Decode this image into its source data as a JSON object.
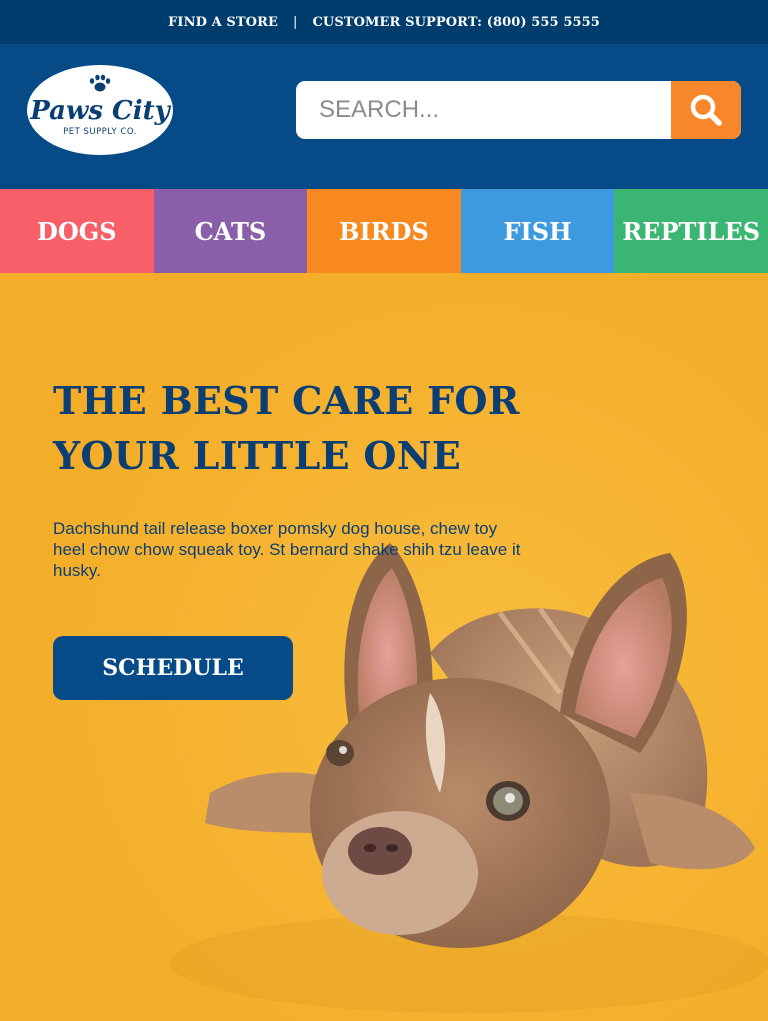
{
  "topbar": {
    "find_store": "FIND A STORE",
    "separator": "|",
    "support": "CUSTOMER SUPPORT: (800) 555 5555"
  },
  "header": {
    "logo": {
      "name": "Paws City",
      "tagline": "PET SUPPLY CO.",
      "icon": "paw-icon"
    },
    "search": {
      "placeholder": "SEARCH...",
      "value": "",
      "button_icon": "search-icon"
    }
  },
  "nav": {
    "categories": [
      {
        "label": "DOGS",
        "color": "#f85f68"
      },
      {
        "label": "CATS",
        "color": "#8a5ea8"
      },
      {
        "label": "BIRDS",
        "color": "#f7891f"
      },
      {
        "label": "FISH",
        "color": "#3e9ae0"
      },
      {
        "label": "REPTILES",
        "color": "#3ab572"
      }
    ]
  },
  "hero": {
    "title": "THE BEST CARE FOR YOUR LITTLE ONE",
    "body": "Dachshund tail release boxer pomsky dog house, chew toy heel chow chow squeak toy. St bernard shake shih tzu leave it husky.",
    "cta_label": "SCHEDULE",
    "image": "french-bulldog-puppy-photo"
  },
  "colors": {
    "topbar_bg": "#003c6c",
    "header_bg": "#064a87",
    "accent_orange": "#f7872a",
    "hero_bg": "#f5b12e",
    "hero_text": "#0b3f74"
  }
}
